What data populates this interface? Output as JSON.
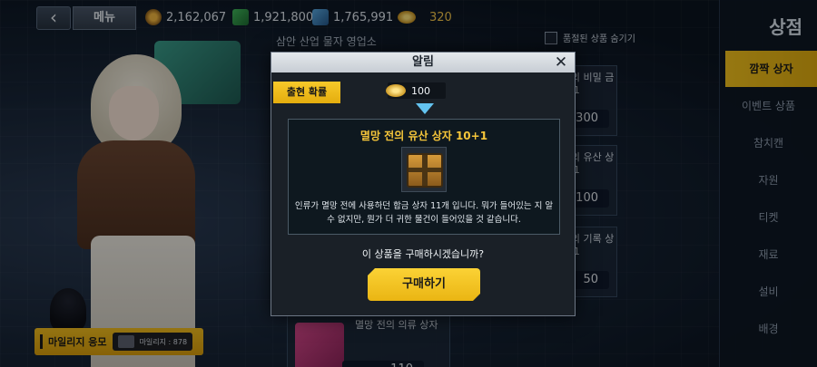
{
  "topbar": {
    "menu_label": "메뉴",
    "resources": [
      {
        "icon": "gear-part-icon",
        "value": "2,162,067"
      },
      {
        "icon": "max-green-icon",
        "value": "1,921,800"
      },
      {
        "icon": "max-blue-icon",
        "value": "1,765,991"
      },
      {
        "icon": "gold-coin-icon",
        "value": "320"
      }
    ]
  },
  "shop": {
    "title": "상점",
    "shop_name": "삼안 산업 물자 영업소",
    "hide_sold_label": "품절된 상품 숨기기",
    "tabs": [
      "깜짝 상자",
      "이벤트 상품",
      "참치캔",
      "자원",
      "티켓",
      "재료",
      "설비",
      "배경"
    ],
    "active_tab": "깜짝 상자",
    "cards": [
      {
        "name": "멸망 전의 비밀 금고 10+1",
        "price": "300"
      },
      {
        "name": "멸망 전의 유산 상자 10+1",
        "price": "100"
      },
      {
        "name": "멸망 전의 기록 상자 10+1",
        "price": "50"
      },
      {
        "name": "멸망 전의 의류 상자",
        "price": "110"
      }
    ]
  },
  "mileage": {
    "label": "마일리지 응모",
    "count_text": "마일리지 : 878"
  },
  "modal": {
    "title": "알림",
    "close_symbol": "✕",
    "prob_tab_label": "출현 확률",
    "cost": "100",
    "item_name": "멸망 전의 유산 상자 10+1",
    "item_desc": "인류가 멸망 전에 사용하던 합금 상자 11개 입니다. 뭐가 들어있는 지 알 수 없지만, 뭔가 더 귀한 물건이 들어있을 것 같습니다.",
    "question": "이 상품을 구매하시겠습니까?",
    "buy_label": "구매하기"
  },
  "colors": {
    "accent_yellow": "#f3c21d",
    "item_title": "#f6c63a",
    "arrow_blue": "#63c3f0"
  }
}
